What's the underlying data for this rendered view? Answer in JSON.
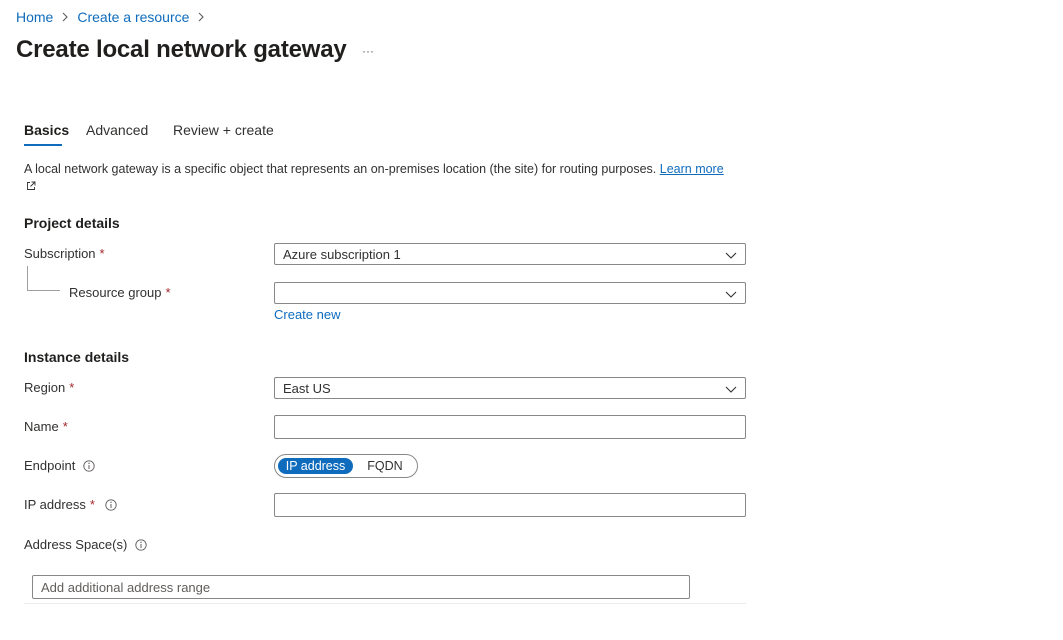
{
  "breadcrumb": {
    "home": "Home",
    "create_resource": "Create a resource"
  },
  "page": {
    "title": "Create local network gateway",
    "more": "···"
  },
  "tabs": [
    {
      "label": "Basics",
      "active": true
    },
    {
      "label": "Advanced",
      "active": false
    },
    {
      "label": "Review + create",
      "active": false
    }
  ],
  "description": {
    "text": "A local network gateway is a specific object that represents an on-premises location (the site) for routing purposes. ",
    "learn_more": "Learn more"
  },
  "project": {
    "heading": "Project details",
    "subscription_label": "Subscription",
    "subscription_value": "Azure subscription 1",
    "resource_group_label": "Resource group",
    "resource_group_value": "",
    "create_new": "Create new"
  },
  "instance": {
    "heading": "Instance details",
    "region_label": "Region",
    "region_value": "East US",
    "name_label": "Name",
    "name_value": "",
    "endpoint_label": "Endpoint",
    "endpoint_options": [
      "IP address",
      "FQDN"
    ],
    "endpoint_selected": "IP address",
    "ip_label": "IP address",
    "ip_value": "",
    "address_space_label": "Address Space(s)",
    "address_placeholder": "Add additional address range"
  },
  "required_marker": "*",
  "colors": {
    "accent": "#0f6cbd",
    "required": "#a4262c",
    "border": "#8a8886"
  }
}
